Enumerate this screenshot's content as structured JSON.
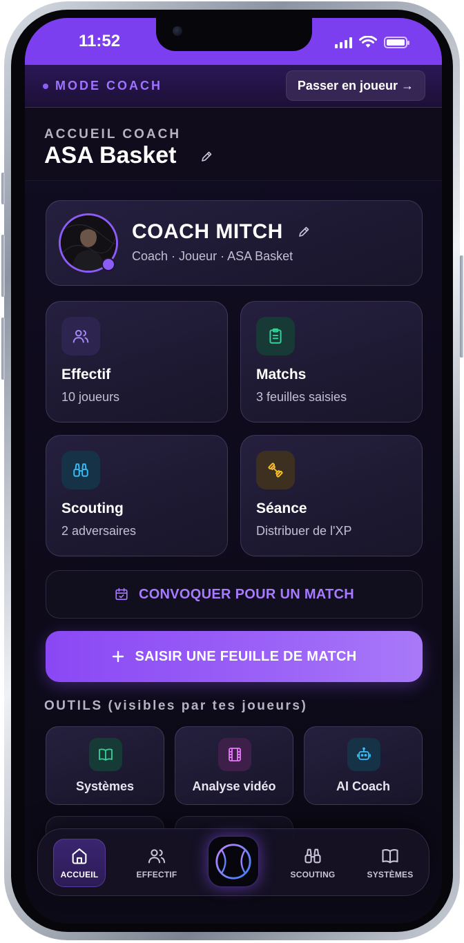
{
  "status_bar": {
    "time": "11:52"
  },
  "mode_bar": {
    "label": "MODE COACH",
    "switch_button": "Passer en joueur →"
  },
  "header": {
    "eyebrow": "ACCUEIL COACH",
    "title": "ASA Basket"
  },
  "profile": {
    "name": "COACH MITCH",
    "subtitle": "Coach · Joueur · ASA Basket"
  },
  "tiles": [
    {
      "title": "Effectif",
      "subtitle": "10 joueurs",
      "icon": "users-icon",
      "color": "#a78bfa",
      "bg": "#2e2450"
    },
    {
      "title": "Matchs",
      "subtitle": "3 feuilles saisies",
      "icon": "clipboard-icon",
      "color": "#34d399",
      "bg": "#173a36"
    },
    {
      "title": "Scouting",
      "subtitle": "2 adversaires",
      "icon": "binoculars-icon",
      "color": "#38bdf8",
      "bg": "#153247"
    },
    {
      "title": "Séance",
      "subtitle": "Distribuer de l'XP",
      "icon": "dumbbell-icon",
      "color": "#fbbf24",
      "bg": "#3d3020"
    }
  ],
  "actions": {
    "convoke": "CONVOQUER POUR UN MATCH",
    "new_match_sheet": "SAISIR UNE FEUILLE DE MATCH"
  },
  "tools_section": {
    "label": "OUTILS (visibles par tes joueurs)",
    "items": [
      {
        "label": "Systèmes",
        "icon": "book-icon",
        "color": "#34d399",
        "bg": "#163a36"
      },
      {
        "label": "Analyse vidéo",
        "icon": "film-icon",
        "color": "#e879f9",
        "bg": "#3d1f4a"
      },
      {
        "label": "AI Coach",
        "icon": "robot-icon",
        "color": "#38bdf8",
        "bg": "#153247"
      }
    ]
  },
  "bottom_nav": {
    "items": [
      {
        "label": "ACCUEIL",
        "icon": "home-icon",
        "active": true
      },
      {
        "label": "EFFECTIF",
        "icon": "users-icon",
        "active": false
      },
      {
        "label": "SCOUTING",
        "icon": "binoculars-icon",
        "active": false
      },
      {
        "label": "SYSTÈMES",
        "icon": "book-icon",
        "active": false
      }
    ],
    "center_icon": "basketball-icon"
  },
  "colors": {
    "accent": "#8b5cf6",
    "accent_text": "#a67bff",
    "background": "#0f0b1d"
  }
}
